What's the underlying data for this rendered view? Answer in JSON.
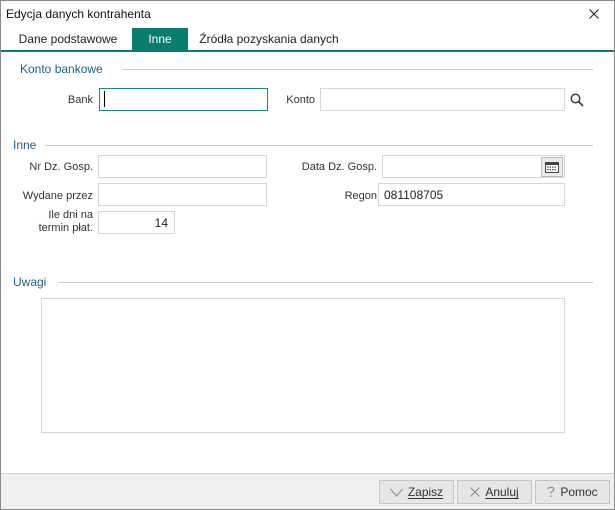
{
  "window": {
    "title": "Edycja danych kontrahenta"
  },
  "tabs": [
    {
      "label": "Dane podstawowe",
      "active": false
    },
    {
      "label": "Inne",
      "active": true
    },
    {
      "label": "Źródła pozyskania danych",
      "active": false
    }
  ],
  "konto_bankowe": {
    "heading": "Konto bankowe",
    "bank_label": "Bank",
    "bank_value": "",
    "konto_label": "Konto",
    "konto_value": ""
  },
  "inne": {
    "heading": "Inne",
    "nr_dz_gosp_label": "Nr Dz. Gosp.",
    "nr_dz_gosp_value": "",
    "data_dz_gosp_label": "Data Dz. Gosp.",
    "data_dz_gosp_value": "",
    "wydane_przez_label": "Wydane przez",
    "wydane_przez_value": "",
    "regon_label": "Regon",
    "regon_value": "081108705",
    "ile_dni_label_line1": "Ile dni na",
    "ile_dni_label_line2": "termin płat.",
    "ile_dni_value": "14"
  },
  "uwagi": {
    "heading": "Uwagi",
    "value": ""
  },
  "footer": {
    "zapisz_label": "Zapisz",
    "anuluj_label": "Anuluj",
    "pomoc_label": "Pomoc"
  },
  "colors": {
    "accent": "#0a7d6c",
    "section_heading": "#1f5f8b"
  },
  "icons": {
    "close": "close-icon",
    "search": "search-icon",
    "calendar": "calendar-icon",
    "save": "checkmark-icon",
    "cancel": "x-icon",
    "help": "question-icon"
  }
}
